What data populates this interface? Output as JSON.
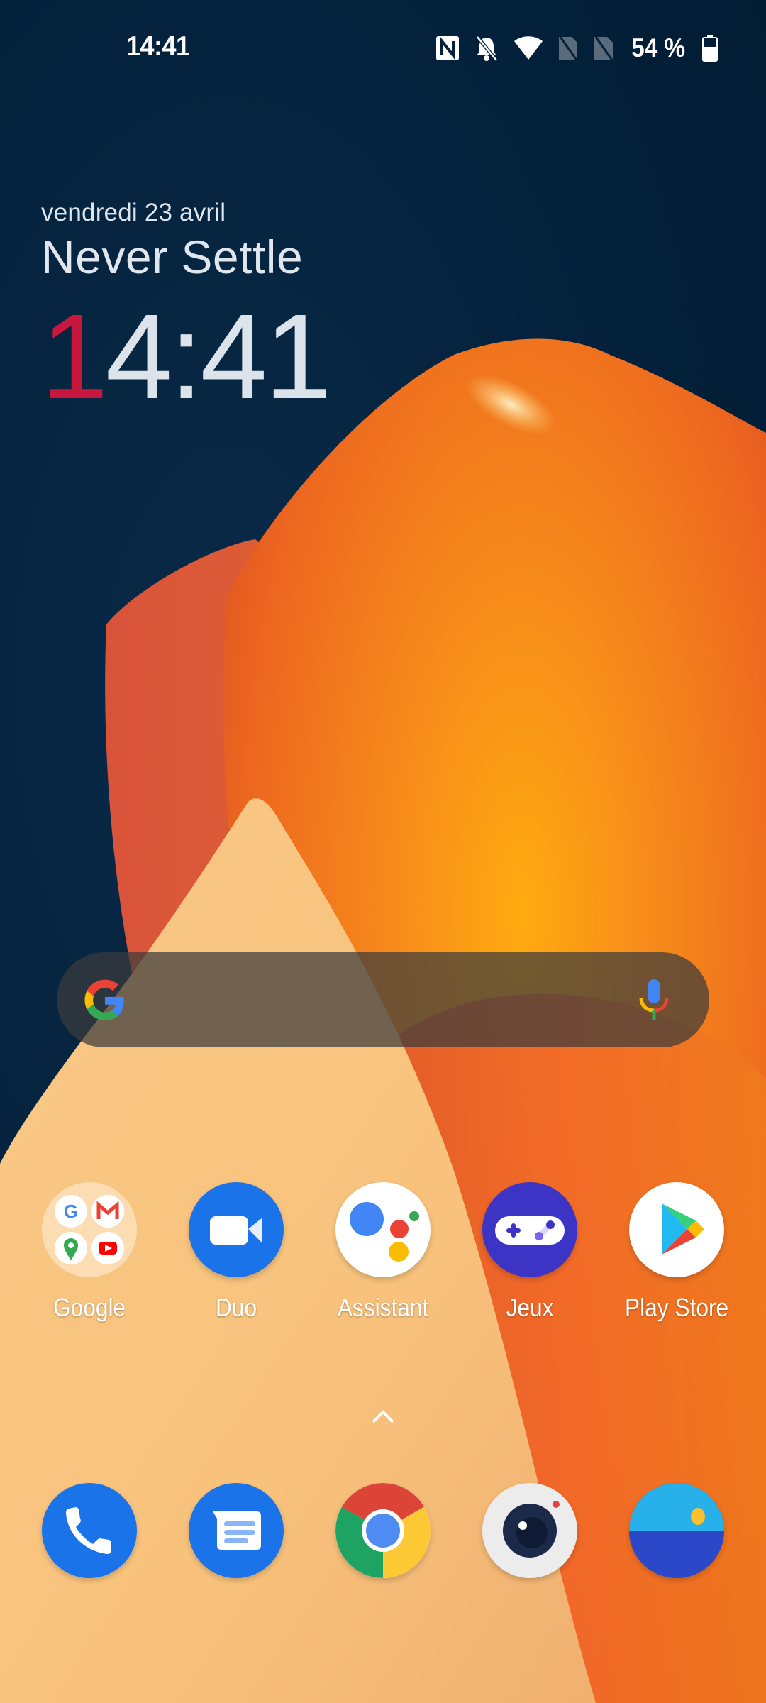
{
  "status_bar": {
    "time": "14:41",
    "icons": [
      "nfc-icon",
      "bell-off-icon",
      "wifi-icon",
      "sim-absent-icon",
      "sim-absent-icon",
      "battery-icon"
    ],
    "battery_percent": "54 %"
  },
  "clock_widget": {
    "date": "vendredi 23 avril",
    "motto": "Never Settle",
    "time_first_digit": "1",
    "time_rest": "4:41"
  },
  "search_bar": {
    "left_icon": "google-g-icon",
    "right_icon": "microphone-icon"
  },
  "apps": [
    {
      "label": "Google",
      "icon": "google-folder-icon"
    },
    {
      "label": "Duo",
      "icon": "duo-video-icon"
    },
    {
      "label": "Assistant",
      "icon": "assistant-icon"
    },
    {
      "label": "Jeux",
      "icon": "gamepad-icon"
    },
    {
      "label": "Play Store",
      "icon": "play-store-icon"
    }
  ],
  "app_drawer_hint": "chevron-up-icon",
  "dock": [
    {
      "name": "Téléphone",
      "icon": "phone-icon"
    },
    {
      "name": "Messages",
      "icon": "messages-icon"
    },
    {
      "name": "Chrome",
      "icon": "chrome-icon"
    },
    {
      "name": "Appareil photo",
      "icon": "camera-icon"
    },
    {
      "name": "Galerie",
      "icon": "gallery-icon"
    }
  ],
  "colors": {
    "background": "#03213b",
    "clock_accent": "#c8173f",
    "wallpaper_orange": "#f07a1c",
    "wallpaper_peach": "#f8c17e"
  }
}
